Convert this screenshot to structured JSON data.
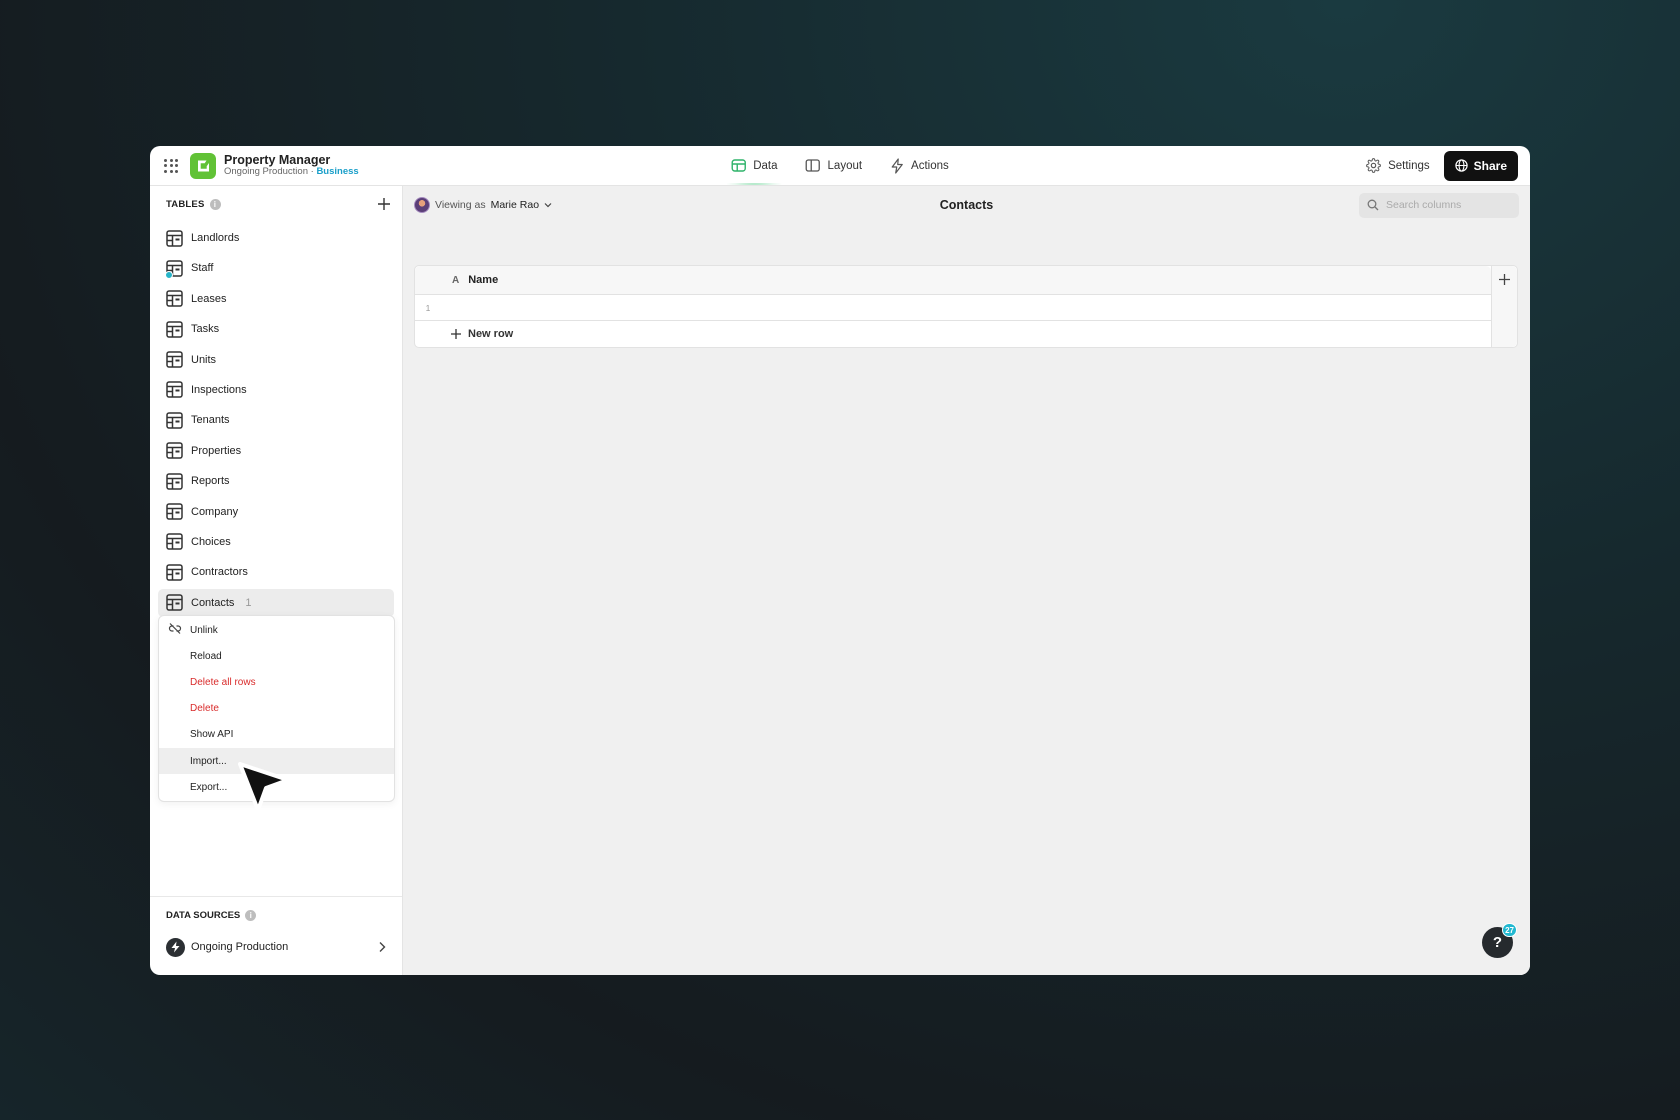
{
  "app": {
    "name": "Property Manager",
    "subtitle": "Ongoing Production",
    "separator": "·",
    "plan": "Business",
    "brand_color": "#61c236"
  },
  "nav": {
    "tabs": [
      {
        "label": "Data",
        "icon": "table-icon",
        "active": true
      },
      {
        "label": "Layout",
        "icon": "layout-icon",
        "active": false
      },
      {
        "label": "Actions",
        "icon": "bolt-icon",
        "active": false
      }
    ],
    "settings_label": "Settings",
    "share_label": "Share"
  },
  "sidebar": {
    "tables_heading": "TABLES",
    "tables": [
      {
        "label": "Landlords"
      },
      {
        "label": "Staff",
        "badge": true
      },
      {
        "label": "Leases"
      },
      {
        "label": "Tasks"
      },
      {
        "label": "Units"
      },
      {
        "label": "Inspections"
      },
      {
        "label": "Tenants"
      },
      {
        "label": "Properties"
      },
      {
        "label": "Reports"
      },
      {
        "label": "Company"
      },
      {
        "label": "Choices"
      },
      {
        "label": "Contractors"
      },
      {
        "label": "Contacts",
        "count": "1",
        "selected": true
      }
    ],
    "context_menu": [
      {
        "label": "Unlink",
        "icon": "unlink-icon"
      },
      {
        "label": "Reload"
      },
      {
        "label": "Delete all rows",
        "danger": true
      },
      {
        "label": "Delete",
        "danger": true
      },
      {
        "label": "Show API"
      },
      {
        "label": "Import...",
        "hover": true
      },
      {
        "label": "Export..."
      }
    ],
    "data_sources_heading": "DATA SOURCES",
    "data_source": "Ongoing Production"
  },
  "main": {
    "viewing_prefix": "Viewing as",
    "viewing_user": "Marie Rao",
    "title": "Contacts",
    "search_placeholder": "Search columns",
    "columns": [
      {
        "type_glyph": "A",
        "label": "Name"
      }
    ],
    "rows": [
      {
        "num": "1",
        "name": ""
      }
    ],
    "new_row_label": "New row"
  },
  "help": {
    "label": "?",
    "badge": "27"
  },
  "colors": {
    "danger": "#d92b2b",
    "accent": "#22b8d0",
    "active_tab": "#2fb36a"
  }
}
